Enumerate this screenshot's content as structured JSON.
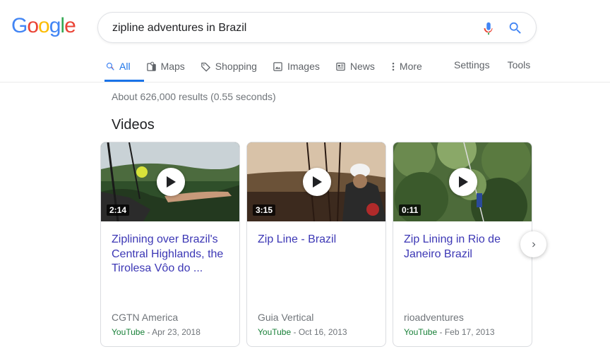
{
  "logo": {
    "letters": [
      "G",
      "o",
      "o",
      "g",
      "l",
      "e"
    ],
    "colors": [
      "#4285f4",
      "#ea4335",
      "#fbbc05",
      "#4285f4",
      "#34a853",
      "#ea4335"
    ]
  },
  "search": {
    "query": "zipline adventures in Brazil"
  },
  "tabs": [
    {
      "label": "All",
      "icon": "search-icon",
      "active": true
    },
    {
      "label": "Maps",
      "icon": "map-icon"
    },
    {
      "label": "Shopping",
      "icon": "tag-icon"
    },
    {
      "label": "Images",
      "icon": "image-icon"
    },
    {
      "label": "News",
      "icon": "news-icon"
    },
    {
      "label": "More",
      "icon": "more-vert-icon"
    }
  ],
  "tools": {
    "settings": "Settings",
    "tools": "Tools"
  },
  "result_stats": "About 626,000 results (0.55 seconds)",
  "videos": {
    "title": "Videos",
    "items": [
      {
        "duration": "2:14",
        "title": "Ziplining over Brazil's Central Highlands, the Tirolesa Vôo do ...",
        "channel": "CGTN America",
        "source": "YouTube",
        "date": "Apr 23, 2018"
      },
      {
        "duration": "3:15",
        "title": "Zip Line - Brazil",
        "channel": "Guia Vertical",
        "source": "YouTube",
        "date": "Oct 16, 2013"
      },
      {
        "duration": "0:11",
        "title": "Zip Lining in Rio de Janeiro Brazil",
        "channel": "rioadventures",
        "source": "YouTube",
        "date": "Feb 17, 2013"
      }
    ]
  },
  "colors": {
    "accent": "#1a73e8",
    "link": "#3c37b5",
    "source_green": "#188038"
  }
}
